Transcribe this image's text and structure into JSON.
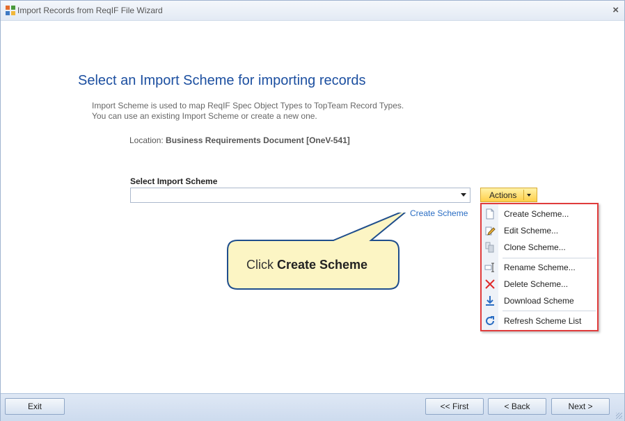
{
  "window": {
    "title": "Import Records from ReqIF File Wizard",
    "close_glyph": "×"
  },
  "page": {
    "heading": "Select an Import Scheme for importing records",
    "description_line1": "Import Scheme is used to map ReqIF Spec Object Types to TopTeam Record Types.",
    "description_line2": "You can use an existing Import Scheme or create a new one.",
    "location_label": "Location:",
    "location_value": "Business Requirements Document [OneV-541]",
    "select_label": "Select Import Scheme",
    "select_value": "",
    "create_scheme_link": "Create Scheme"
  },
  "actions": {
    "button_label": "Actions",
    "menu": [
      {
        "label": "Create Scheme...",
        "icon": "new-document-icon"
      },
      {
        "label": "Edit Scheme...",
        "icon": "edit-icon"
      },
      {
        "label": "Clone Scheme...",
        "icon": "clone-icon"
      },
      {
        "label": "Rename Scheme...",
        "icon": "rename-icon"
      },
      {
        "label": "Delete Scheme...",
        "icon": "delete-icon"
      },
      {
        "label": "Download Scheme",
        "icon": "download-icon"
      },
      {
        "label": "Refresh Scheme List",
        "icon": "refresh-icon"
      }
    ]
  },
  "callout": {
    "prefix": "Click ",
    "emphasis": "Create Scheme"
  },
  "footer": {
    "exit": "Exit",
    "first": "<< First",
    "back": "< Back",
    "next": "Next >"
  },
  "colors": {
    "heading": "#1c4fa0",
    "link": "#2a6dc3",
    "menu_border": "#e03c3c",
    "callout_fill": "#fcf5c4",
    "callout_border": "#1f4e8c"
  }
}
